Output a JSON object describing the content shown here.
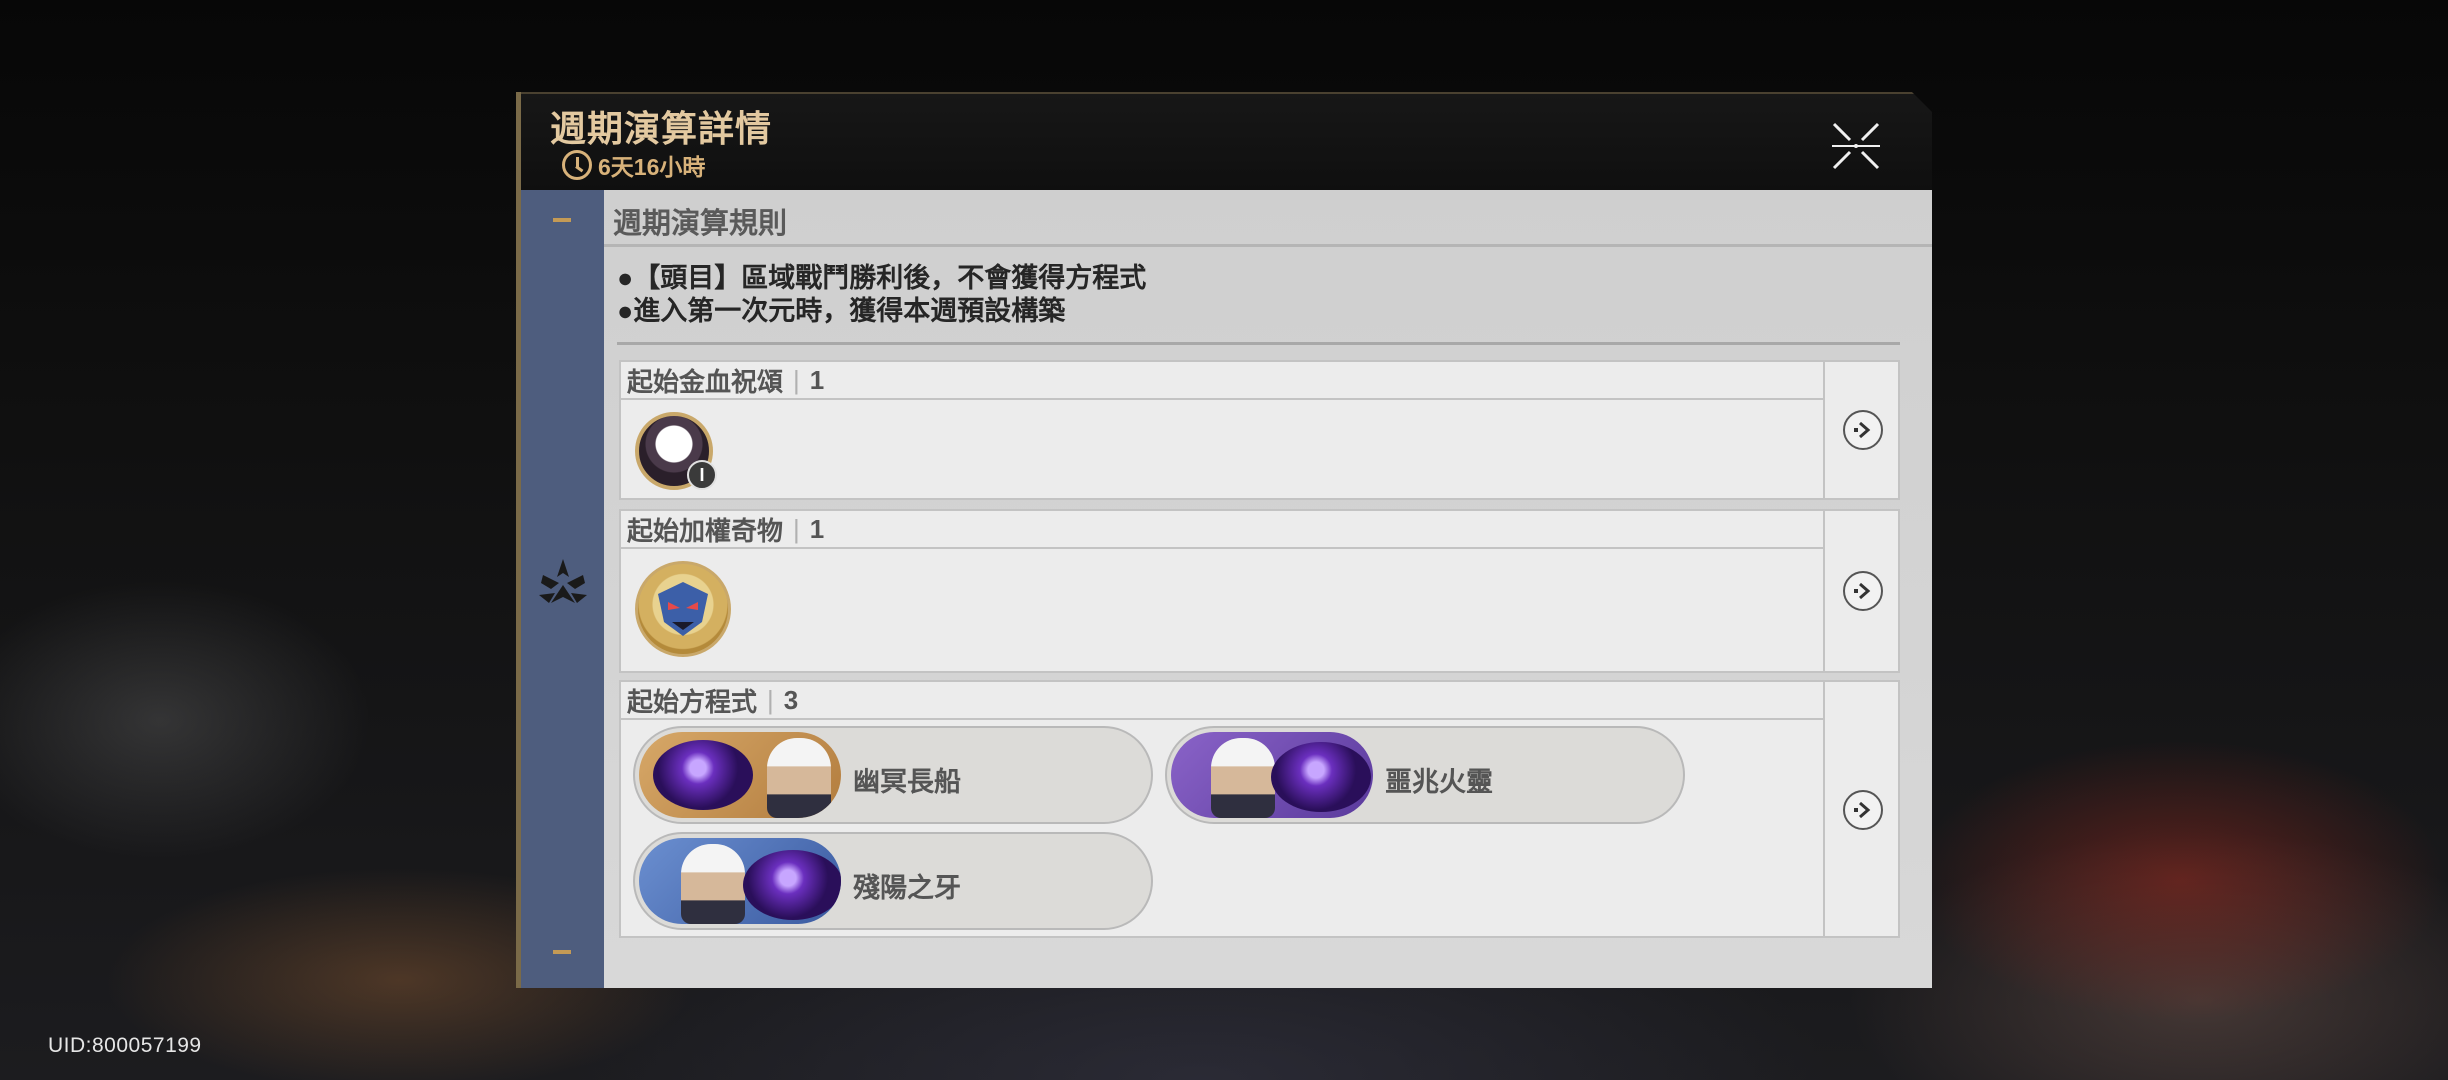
{
  "modal": {
    "title": "週期演算詳情",
    "timer": "6天16小時"
  },
  "rules": {
    "title": "週期演算規則",
    "items": [
      "●【頭目】區域戰鬥勝利後，不會獲得方程式",
      "●進入第一次元時，獲得本週預設構築"
    ]
  },
  "blocks": {
    "blessing": {
      "label": "起始金血祝頌",
      "count": "1",
      "badge": "I"
    },
    "artifact": {
      "label": "起始加權奇物",
      "count": "1"
    },
    "equation": {
      "label": "起始方程式",
      "count": "3",
      "items": [
        {
          "name": "幽冥長船"
        },
        {
          "name": "噩兆火靈"
        },
        {
          "name": "殘陽之牙"
        }
      ]
    }
  },
  "footer": {
    "uid": "UID:800057199"
  },
  "colors": {
    "accent_gold": "#e3c9a0",
    "side_strip": "#4e5d7e",
    "panel_bg": "#d8d8d8"
  }
}
